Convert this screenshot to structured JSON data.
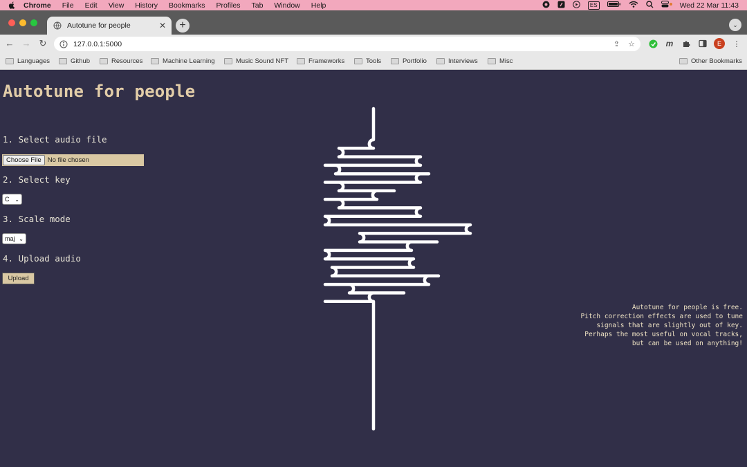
{
  "menubar": {
    "app": "Chrome",
    "items": [
      "File",
      "Edit",
      "View",
      "History",
      "Bookmarks",
      "Profiles",
      "Tab",
      "Window",
      "Help"
    ],
    "input_source": "ES",
    "datetime": "Wed 22 Mar  11:43"
  },
  "browser": {
    "tab_title": "Autotune for people",
    "url": "127.0.0.1:5000",
    "avatar_initial": "E",
    "bookmarks": [
      "Languages",
      "Github",
      "Resources",
      "Machine Learning",
      "Music Sound NFT",
      "Frameworks",
      "Tools",
      "Portfolio",
      "Interviews",
      "Misc"
    ],
    "other_bookmarks": "Other Bookmarks"
  },
  "page": {
    "title": "Autotune for people",
    "step1": "1. Select audio file",
    "choose_file": "Choose File",
    "no_file": "No file chosen",
    "step2": "2. Select key",
    "key_value": "C",
    "step3": "3. Scale mode",
    "mode_value": "maj",
    "step4": "4. Upload audio",
    "upload_label": "Upload",
    "description": [
      "Autotune for people is free.",
      "Pitch correction effects are used to tune",
      "signals that are slightly out of key.",
      "Perhaps the most useful on vocal tracks,",
      "but can be used on anything!"
    ]
  },
  "colors": {
    "background": "#312f48",
    "accent": "#d9c8a3",
    "menubar": "#f2a8bd"
  }
}
